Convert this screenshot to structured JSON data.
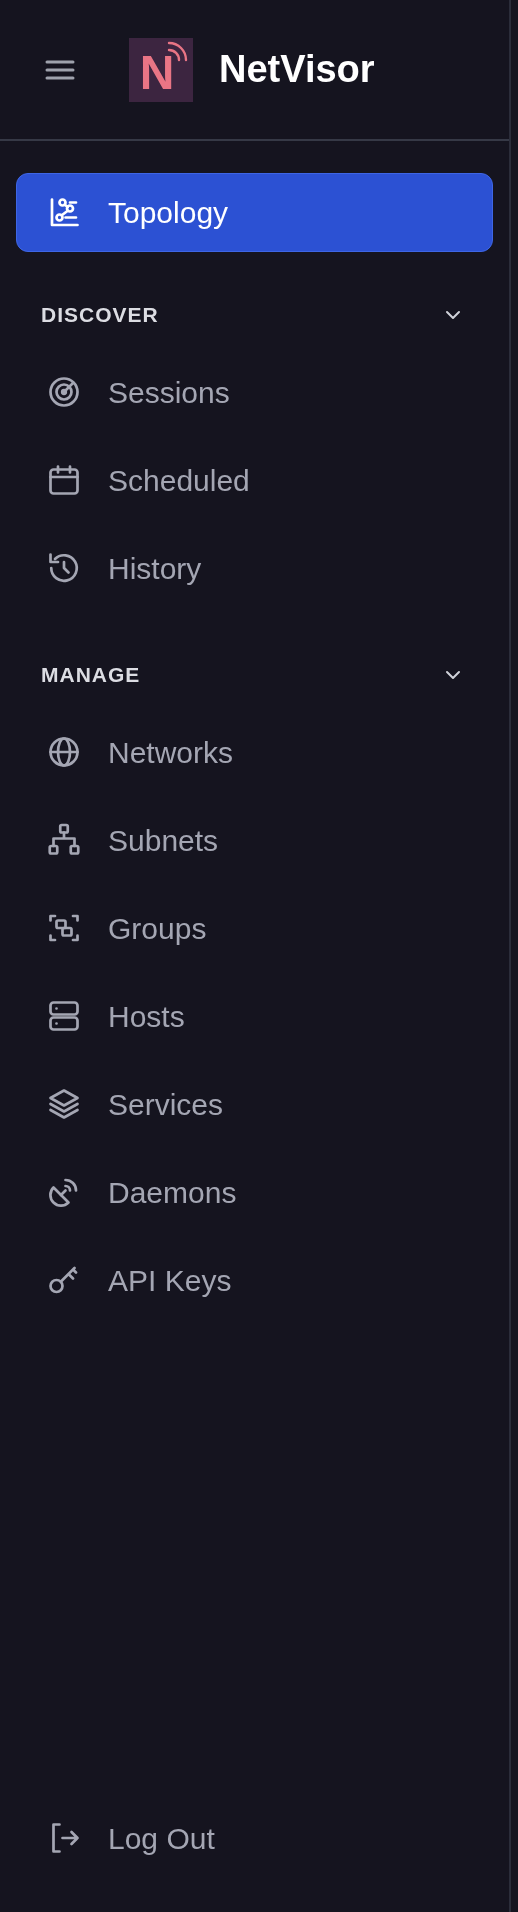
{
  "header": {
    "logo_letter": "N",
    "title": "NetVisor"
  },
  "nav": [
    {
      "label": "Topology",
      "selected": true
    }
  ],
  "sections": [
    {
      "title": "DISCOVER",
      "expanded": true,
      "items": [
        {
          "label": "Sessions",
          "selected": false
        },
        {
          "label": "Scheduled",
          "selected": false
        },
        {
          "label": "History",
          "selected": false
        }
      ]
    },
    {
      "title": "MANAGE",
      "expanded": true,
      "items": [
        {
          "label": "Networks",
          "selected": false
        },
        {
          "label": "Subnets",
          "selected": false
        },
        {
          "label": "Groups",
          "selected": false
        },
        {
          "label": "Hosts",
          "selected": false
        },
        {
          "label": "Services",
          "selected": false
        },
        {
          "label": "Daemons",
          "selected": false
        },
        {
          "label": "API Keys",
          "selected": false
        }
      ]
    }
  ],
  "footer": {
    "logout": "Log Out"
  }
}
